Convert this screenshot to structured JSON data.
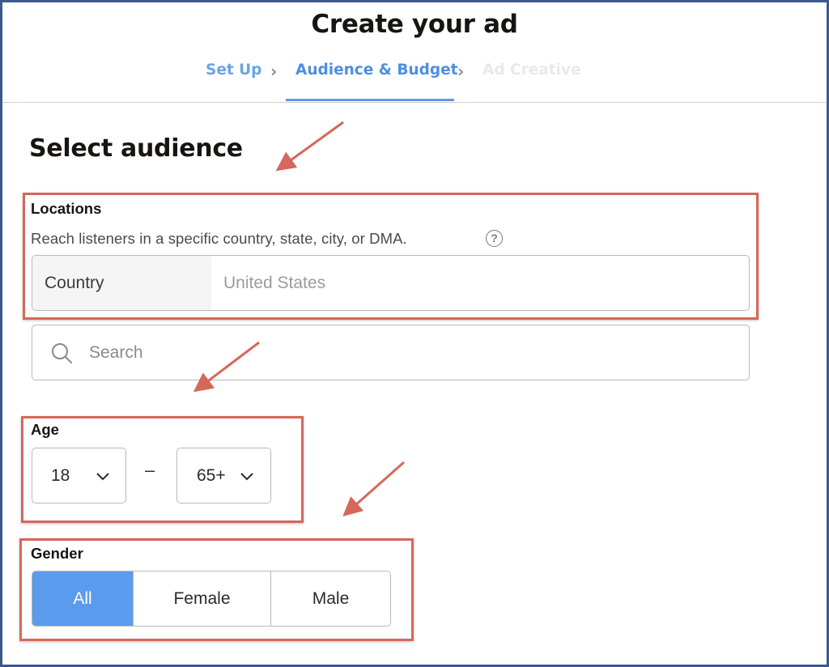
{
  "header": {
    "title": "Create your ad",
    "steps": [
      {
        "label": "Set Up",
        "state": "completed"
      },
      {
        "label": "Audience & Budget",
        "state": "active"
      },
      {
        "label": "Ad Creative",
        "state": "upcoming"
      }
    ],
    "separator_icon": "chevron-right-icon"
  },
  "section": {
    "title": "Select audience"
  },
  "locations": {
    "label": "Locations",
    "help_text": "Reach listeners in a specific country, state, city, or DMA.",
    "help_icon": "?",
    "type_label": "Country",
    "value": "United States",
    "search_placeholder": "Search",
    "search_icon": "search-icon"
  },
  "age": {
    "label": "Age",
    "min": "18",
    "separator": "–",
    "max": "65+",
    "chevron_icon": "chevron-down-icon"
  },
  "gender": {
    "label": "Gender",
    "options": [
      {
        "label": "All",
        "selected": true
      },
      {
        "label": "Female",
        "selected": false
      },
      {
        "label": "Male",
        "selected": false
      }
    ]
  },
  "colors": {
    "accent_blue": "#5b9bed",
    "highlight_red": "#d5685a",
    "frame_blue": "#3d5a8c"
  }
}
